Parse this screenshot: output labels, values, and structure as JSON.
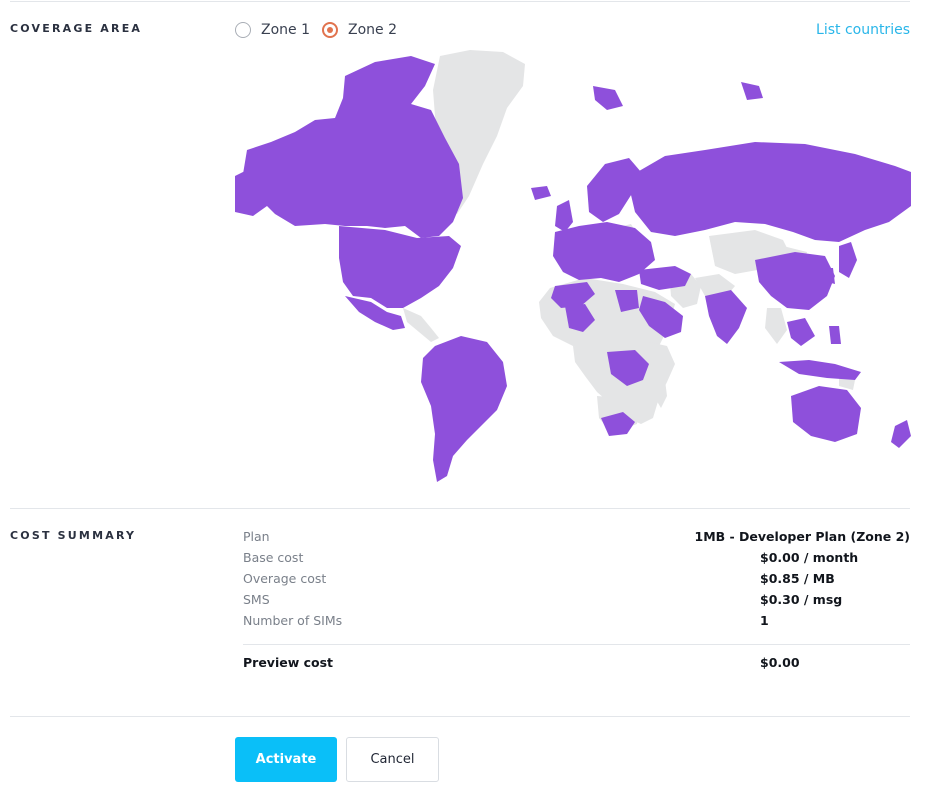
{
  "coverage": {
    "label": "COVERAGE AREA",
    "zones": [
      {
        "label": "Zone 1",
        "selected": false
      },
      {
        "label": "Zone 2",
        "selected": true
      }
    ],
    "list_link": "List countries",
    "colors": {
      "covered": "#8e50db",
      "uncovered": "#e4e5e6",
      "accent": "#e1734e",
      "link": "#29b6e9"
    }
  },
  "cost_summary": {
    "label": "COST SUMMARY",
    "plan": {
      "label": "Plan",
      "value": "1MB - Developer Plan (Zone 2)"
    },
    "rows": [
      {
        "label": "Base cost",
        "value": "$0.00 / month"
      },
      {
        "label": "Overage cost",
        "value": "$0.85 / MB"
      },
      {
        "label": "SMS",
        "value": "$0.30 / msg"
      },
      {
        "label": "Number of SIMs",
        "value": "1"
      }
    ],
    "preview": {
      "label": "Preview cost",
      "value": "$0.00"
    }
  },
  "actions": {
    "activate_label": "Activate",
    "cancel_label": "Cancel",
    "primary_color": "#0abff8"
  }
}
